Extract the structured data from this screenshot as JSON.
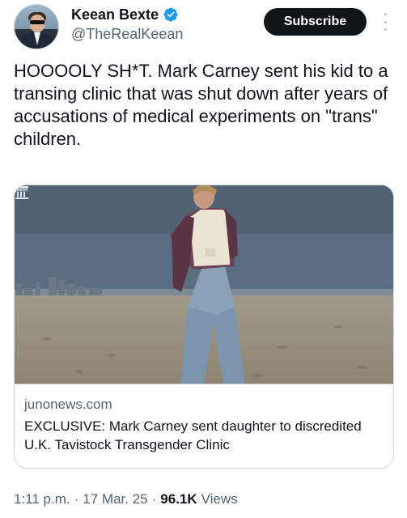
{
  "author": {
    "display_name": "Keean Bexte",
    "handle": "@TheRealKeean",
    "verified": true,
    "avatar_icon": "avatar-photo"
  },
  "actions": {
    "subscribe_label": "Subscribe",
    "more_icon": "more-vertical-icon"
  },
  "tweet": {
    "text": "HOOOOLY SH*T. Mark Carney sent his kid to a transing clinic that was shut down after years of accusations of medical experiments on \"trans\" children."
  },
  "card": {
    "domain": "junonews.com",
    "title": "EXCLUSIVE: Mark Carney sent daughter to discredited U.K. Tavistock Transgender Clinic",
    "image_icon": "reader-mode-icon"
  },
  "footer": {
    "time": "1:11 p.m.",
    "date": "17 Mar. 25",
    "views_count": "96.1K",
    "views_label": "Views"
  },
  "colors": {
    "text_primary": "#0f1419",
    "text_secondary": "#536471",
    "verified_blue": "#1d9bf0",
    "border": "#cfd9de"
  }
}
